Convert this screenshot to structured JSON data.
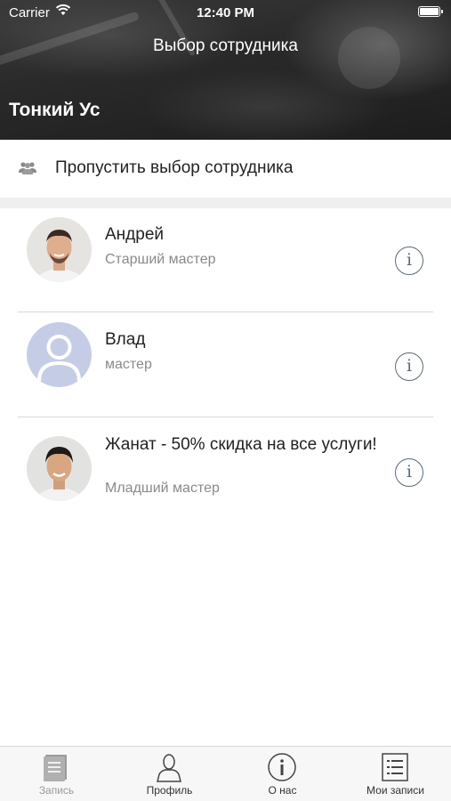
{
  "status_bar": {
    "carrier": "Carrier",
    "time": "12:40 PM"
  },
  "header": {
    "title": "Выбор сотрудника",
    "salon_name": "Тонкий Ус"
  },
  "skip": {
    "label": "Пропустить выбор сотрудника",
    "icon": "people-icon"
  },
  "staff": [
    {
      "name": "Андрей",
      "role": "Старший мастер",
      "avatar": "photo"
    },
    {
      "name": "Влад",
      "role": "мастер",
      "avatar": "placeholder"
    },
    {
      "name": "Жанат - 50% скидка на все услуги!",
      "role": "Младший мастер",
      "avatar": "photo"
    }
  ],
  "tabs": [
    {
      "label": "Запись",
      "icon": "book-icon",
      "active": true
    },
    {
      "label": "Профиль",
      "icon": "person-icon",
      "active": false
    },
    {
      "label": "О нас",
      "icon": "info-icon",
      "active": false
    },
    {
      "label": "Мои записи",
      "icon": "list-icon",
      "active": false
    }
  ],
  "colors": {
    "info_icon": "#5a6a78",
    "placeholder_avatar": "#c5cde6",
    "band": "#efefef"
  }
}
